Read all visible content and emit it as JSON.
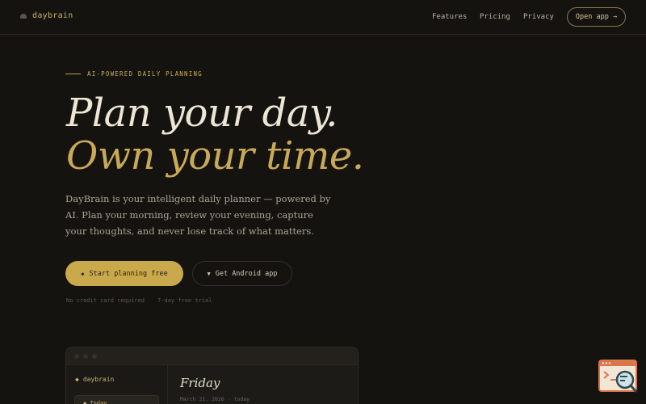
{
  "nav": {
    "brand": "daybrain",
    "links": [
      "Features",
      "Pricing",
      "Privacy"
    ],
    "cta": "Open app →"
  },
  "hero": {
    "eyebrow": "AI-POWERED DAILY PLANNING",
    "title_line1": "Plan your day.",
    "title_line2": "Own your time.",
    "description": "DayBrain is your intelligent daily planner — powered by AI. Plan your morning, review your evening, capture your thoughts, and never lose track of what matters.",
    "primary_button": "Start planning free",
    "primary_icon": "◆",
    "secondary_button": "Get Android app",
    "secondary_icon": "▼",
    "notes": [
      "No credit card required",
      "7-day free trial"
    ]
  },
  "preview": {
    "brand": "daybrain",
    "brand_icon": "◆",
    "sidebar_today": "◆ Today",
    "day": "Friday",
    "date": "March 21, 2026 · today"
  },
  "colors": {
    "background": "#141310",
    "accent_gold": "#c9a94b",
    "title_light": "#ece6d4",
    "title_gold": "#c9a957"
  },
  "icons": {
    "brand": "cloud-icon",
    "widget": "browser-search-icon"
  }
}
